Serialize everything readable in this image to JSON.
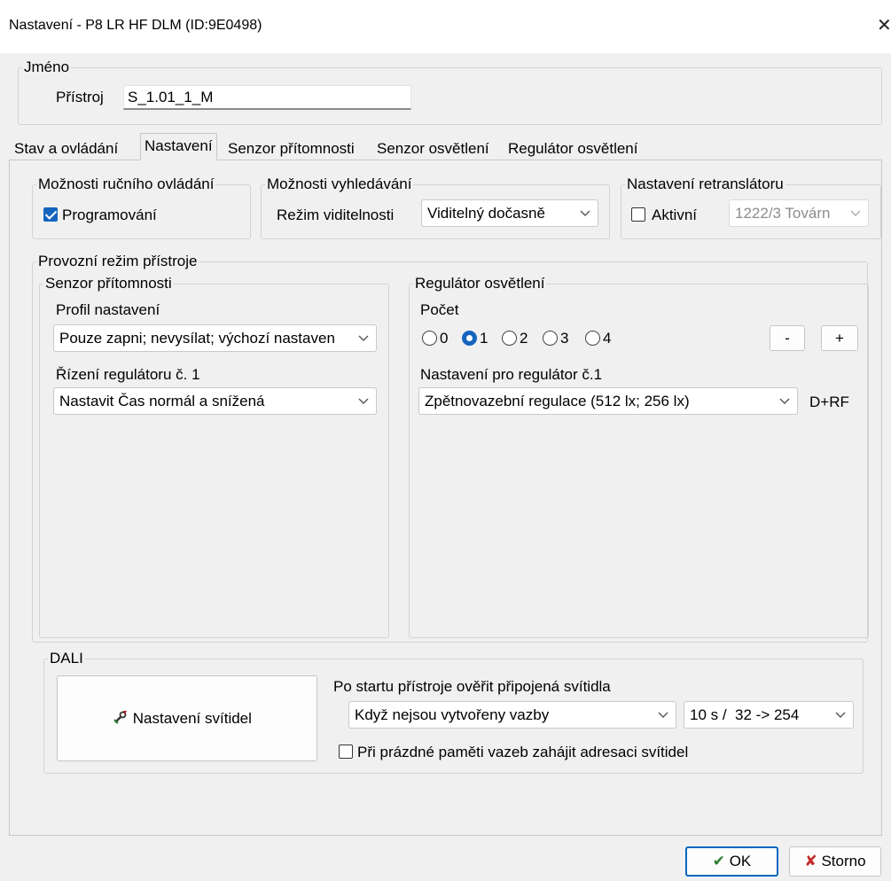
{
  "window": {
    "title": "Nastavení - P8 LR HF DLM (ID:9E0498)",
    "close_glyph": "✕"
  },
  "name_group": {
    "legend": "Jméno",
    "device_label": "Přístroj",
    "device_value": "S_1.01_1_M"
  },
  "tabs": [
    {
      "label": "Stav a ovládání"
    },
    {
      "label": "Nastavení"
    },
    {
      "label": "Senzor přítomnosti"
    },
    {
      "label": "Senzor osvětlení"
    },
    {
      "label": "Regulátor osvětlení"
    }
  ],
  "manual_control": {
    "legend": "Možnosti ručního ovládání",
    "programming_label": "Programování",
    "programming_checked": true
  },
  "search_options": {
    "legend": "Možnosti vyhledávání",
    "visibility_label": "Režim viditelnosti",
    "visibility_value": "Viditelný dočasně"
  },
  "retranslator": {
    "legend": "Nastavení retranslátoru",
    "active_label": "Aktivní",
    "active_checked": false,
    "value": "1222/3 Továrn"
  },
  "operating_mode": {
    "legend": "Provozní režim přístroje",
    "presence_sensor": {
      "legend": "Senzor přítomnosti",
      "profile_label": "Profil nastavení",
      "profile_value": "Pouze zapni; nevysílat; výchozí nastaven",
      "regulator_label": "Řízení regulátoru č. 1",
      "regulator_value": "Nastavit Čas normál a snížená"
    },
    "light_regulator": {
      "legend": "Regulátor osvětlení",
      "count_label": "Počet",
      "count_options": [
        "0",
        "1",
        "2",
        "3",
        "4"
      ],
      "count_selected": "1",
      "minus_label": "-",
      "plus_label": "+",
      "setting_label": "Nastavení pro regulátor č.1",
      "setting_value": "Zpětnovazební regulace (512 lx; 256 lx)",
      "suffix": "D+RF"
    }
  },
  "dali": {
    "legend": "DALI",
    "luminaires_button": "Nastavení svítidel",
    "verify_label": "Po startu přístroje ověřit připojená svítidla",
    "verify_value": "Když nejsou vytvořeny vazby",
    "timing_value": "10 s /  32 -> 254",
    "addressing_label": "Při prázdné paměti vazeb zahájit adresaci svítidel",
    "addressing_checked": false
  },
  "footer": {
    "ok_label": "OK",
    "cancel_label": "Storno"
  },
  "colors": {
    "accent": "#1565c0",
    "ok_check": "#2e7d32",
    "cancel_x": "#c62828"
  }
}
